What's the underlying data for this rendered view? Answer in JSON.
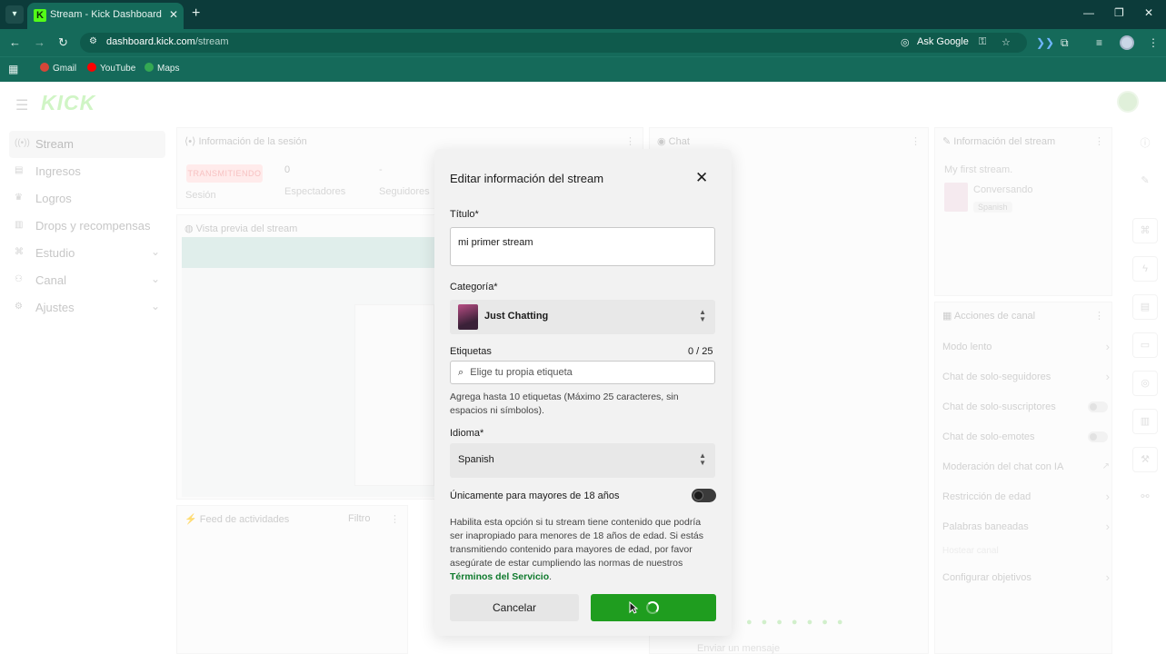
{
  "browser": {
    "tab_title": "Stream - Kick Dashboard",
    "url_domain": "dashboard.kick.com",
    "url_path": "/stream",
    "ask_google": "Ask Google",
    "bookmarks": [
      {
        "label": "Gmail",
        "color": "#d44638"
      },
      {
        "label": "YouTube",
        "color": "#ff0000"
      },
      {
        "label": "Maps",
        "color": "#34a853"
      }
    ]
  },
  "app": {
    "logo": "KICK",
    "sidebar": [
      {
        "label": "Stream",
        "icon": "broadcast-icon"
      },
      {
        "label": "Ingresos",
        "icon": "wallet-icon"
      },
      {
        "label": "Logros",
        "icon": "trophy-icon"
      },
      {
        "label": "Drops y recompensas",
        "icon": "gift-icon"
      },
      {
        "label": "Estudio",
        "icon": "studio-icon"
      },
      {
        "label": "Canal",
        "icon": "channel-icon"
      },
      {
        "label": "Ajustes",
        "icon": "gear-icon"
      }
    ],
    "session": {
      "title": "Información de la sesión",
      "badge": "TRANSMITIENDO",
      "session_label": "Sesión",
      "viewers_value": "0",
      "viewers_label": "Espectadores",
      "followers_value": "-",
      "followers_label": "Seguidores"
    },
    "preview": {
      "title": "Vista previa del stream"
    },
    "feed": {
      "title": "Feed de actividades",
      "filter": "Filtro"
    },
    "chat": {
      "title": "Chat",
      "input_placeholder": "Enviar un mensaje"
    },
    "stream_info": {
      "title": "Información del stream",
      "stream_title": "My first stream.",
      "category": "Conversando",
      "language": "Spanish"
    },
    "channel_actions": {
      "title": "Acciones de canal",
      "items": [
        "Modo lento",
        "Chat de solo-seguidores",
        "Chat de solo-suscriptores",
        "Chat de solo-emotes",
        "Moderación del chat con IA",
        "Restricción de edad",
        "Palabras baneadas",
        "Hostear canal",
        "Configurar objetivos"
      ]
    }
  },
  "modal": {
    "title": "Editar información del stream",
    "title_label": "Título*",
    "title_value": "mi primer stream",
    "category_label": "Categoría*",
    "category_value": "Just Chatting",
    "tags_label": "Etiquetas",
    "tags_count": "0 / 25",
    "tags_placeholder": "Elige tu propia etiqueta",
    "tags_help": "Agrega hasta 10 etiquetas (Máximo 25 caracteres, sin espacios ni símbolos).",
    "language_label": "Idioma*",
    "language_value": "Spanish",
    "mature_label": "Únicamente para mayores de 18 años",
    "mature_enabled": false,
    "mature_help": "Habilita esta opción si tu stream tiene contenido que podría ser inapropiado para menores de 18 años de edad. Si estás transmitiendo contenido para mayores de edad, por favor asegúrate de estar cumpliendo las normas de nuestros",
    "tos_link": "Términos del Servicio",
    "tos_end": ".",
    "cancel_label": "Cancelar",
    "save_state": "loading",
    "accent_color": "#1f9d1f"
  }
}
